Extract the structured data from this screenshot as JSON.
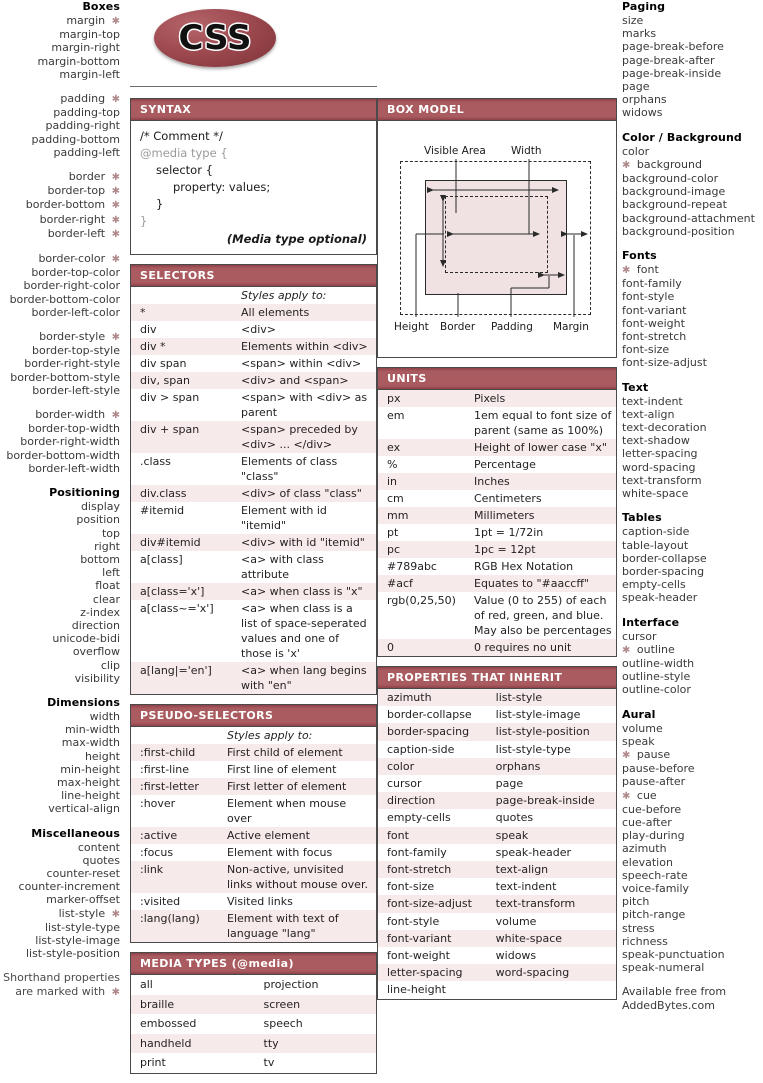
{
  "logo": {
    "text": "CSS"
  },
  "left_column": {
    "groups": [
      {
        "title": "Boxes",
        "items": [
          {
            "label": "margin",
            "star": true
          },
          {
            "label": "margin-top",
            "star": false
          },
          {
            "label": "margin-right",
            "star": false
          },
          {
            "label": "margin-bottom",
            "star": false
          },
          {
            "label": "margin-left",
            "star": false
          }
        ]
      },
      {
        "title": "",
        "items": [
          {
            "label": "padding",
            "star": true
          },
          {
            "label": "padding-top",
            "star": false
          },
          {
            "label": "padding-right",
            "star": false
          },
          {
            "label": "padding-bottom",
            "star": false
          },
          {
            "label": "padding-left",
            "star": false
          }
        ]
      },
      {
        "title": "",
        "items": [
          {
            "label": "border",
            "star": true
          },
          {
            "label": "border-top",
            "star": true
          },
          {
            "label": "border-bottom",
            "star": true
          },
          {
            "label": "border-right",
            "star": true
          },
          {
            "label": "border-left",
            "star": true
          }
        ]
      },
      {
        "title": "",
        "items": [
          {
            "label": "border-color",
            "star": true
          },
          {
            "label": "border-top-color",
            "star": false
          },
          {
            "label": "border-right-color",
            "star": false
          },
          {
            "label": "border-bottom-color",
            "star": false
          },
          {
            "label": "border-left-color",
            "star": false
          }
        ]
      },
      {
        "title": "",
        "items": [
          {
            "label": "border-style",
            "star": true
          },
          {
            "label": "border-top-style",
            "star": false
          },
          {
            "label": "border-right-style",
            "star": false
          },
          {
            "label": "border-bottom-style",
            "star": false
          },
          {
            "label": "border-left-style",
            "star": false
          }
        ]
      },
      {
        "title": "",
        "items": [
          {
            "label": "border-width",
            "star": true
          },
          {
            "label": "border-top-width",
            "star": false
          },
          {
            "label": "border-right-width",
            "star": false
          },
          {
            "label": "border-bottom-width",
            "star": false
          },
          {
            "label": "border-left-width",
            "star": false
          }
        ]
      },
      {
        "title": "Positioning",
        "items": [
          {
            "label": "display",
            "star": false
          },
          {
            "label": "position",
            "star": false
          },
          {
            "label": "top",
            "star": false
          },
          {
            "label": "right",
            "star": false
          },
          {
            "label": "bottom",
            "star": false
          },
          {
            "label": "left",
            "star": false
          },
          {
            "label": "float",
            "star": false
          },
          {
            "label": "clear",
            "star": false
          },
          {
            "label": "z-index",
            "star": false
          },
          {
            "label": "direction",
            "star": false
          },
          {
            "label": "unicode-bidi",
            "star": false
          },
          {
            "label": "overflow",
            "star": false
          },
          {
            "label": "clip",
            "star": false
          },
          {
            "label": "visibility",
            "star": false
          }
        ]
      },
      {
        "title": "Dimensions",
        "items": [
          {
            "label": "width",
            "star": false
          },
          {
            "label": "min-width",
            "star": false
          },
          {
            "label": "max-width",
            "star": false
          },
          {
            "label": "height",
            "star": false
          },
          {
            "label": "min-height",
            "star": false
          },
          {
            "label": "max-height",
            "star": false
          },
          {
            "label": "line-height",
            "star": false
          },
          {
            "label": "vertical-align",
            "star": false
          }
        ]
      },
      {
        "title": "Miscellaneous",
        "items": [
          {
            "label": "content",
            "star": false
          },
          {
            "label": "quotes",
            "star": false
          },
          {
            "label": "counter-reset",
            "star": false
          },
          {
            "label": "counter-increment",
            "star": false
          },
          {
            "label": "marker-offset",
            "star": false
          },
          {
            "label": "list-style",
            "star": true
          },
          {
            "label": "list-style-type",
            "star": false
          },
          {
            "label": "list-style-image",
            "star": false
          },
          {
            "label": "list-style-position",
            "star": false
          }
        ]
      }
    ],
    "footnote_line1": "Shorthand properties",
    "footnote_line2": "are marked with"
  },
  "right_column": {
    "groups": [
      {
        "title": "Paging",
        "items": [
          {
            "label": "size",
            "star": false
          },
          {
            "label": "marks",
            "star": false
          },
          {
            "label": "page-break-before",
            "star": false
          },
          {
            "label": "page-break-after",
            "star": false
          },
          {
            "label": "page-break-inside",
            "star": false
          },
          {
            "label": "page",
            "star": false
          },
          {
            "label": "orphans",
            "star": false
          },
          {
            "label": "widows",
            "star": false
          }
        ]
      },
      {
        "title": "Color / Background",
        "items": [
          {
            "label": "color",
            "star": false
          },
          {
            "label": "background",
            "star": true
          },
          {
            "label": "background-color",
            "star": false
          },
          {
            "label": "background-image",
            "star": false
          },
          {
            "label": "background-repeat",
            "star": false
          },
          {
            "label": "background-attachment",
            "star": false
          },
          {
            "label": "background-position",
            "star": false
          }
        ]
      },
      {
        "title": "Fonts",
        "items": [
          {
            "label": "font",
            "star": true
          },
          {
            "label": "font-family",
            "star": false
          },
          {
            "label": "font-style",
            "star": false
          },
          {
            "label": "font-variant",
            "star": false
          },
          {
            "label": "font-weight",
            "star": false
          },
          {
            "label": "font-stretch",
            "star": false
          },
          {
            "label": "font-size",
            "star": false
          },
          {
            "label": "font-size-adjust",
            "star": false
          }
        ]
      },
      {
        "title": "Text",
        "items": [
          {
            "label": "text-indent",
            "star": false
          },
          {
            "label": "text-align",
            "star": false
          },
          {
            "label": "text-decoration",
            "star": false
          },
          {
            "label": "text-shadow",
            "star": false
          },
          {
            "label": "letter-spacing",
            "star": false
          },
          {
            "label": "word-spacing",
            "star": false
          },
          {
            "label": "text-transform",
            "star": false
          },
          {
            "label": "white-space",
            "star": false
          }
        ]
      },
      {
        "title": "Tables",
        "items": [
          {
            "label": "caption-side",
            "star": false
          },
          {
            "label": "table-layout",
            "star": false
          },
          {
            "label": "border-collapse",
            "star": false
          },
          {
            "label": "border-spacing",
            "star": false
          },
          {
            "label": "empty-cells",
            "star": false
          },
          {
            "label": "speak-header",
            "star": false
          }
        ]
      },
      {
        "title": "Interface",
        "items": [
          {
            "label": "cursor",
            "star": false
          },
          {
            "label": "outline",
            "star": true
          },
          {
            "label": "outline-width",
            "star": false
          },
          {
            "label": "outline-style",
            "star": false
          },
          {
            "label": "outline-color",
            "star": false
          }
        ]
      },
      {
        "title": "Aural",
        "items": [
          {
            "label": "volume",
            "star": false
          },
          {
            "label": "speak",
            "star": false
          },
          {
            "label": "pause",
            "star": true
          },
          {
            "label": "pause-before",
            "star": false
          },
          {
            "label": "pause-after",
            "star": false
          },
          {
            "label": "cue",
            "star": true
          },
          {
            "label": "cue-before",
            "star": false
          },
          {
            "label": "cue-after",
            "star": false
          },
          {
            "label": "play-during",
            "star": false
          },
          {
            "label": "azimuth",
            "star": false
          },
          {
            "label": "elevation",
            "star": false
          },
          {
            "label": "speech-rate",
            "star": false
          },
          {
            "label": "voice-family",
            "star": false
          },
          {
            "label": "pitch",
            "star": false
          },
          {
            "label": "pitch-range",
            "star": false
          },
          {
            "label": "stress",
            "star": false
          },
          {
            "label": "richness",
            "star": false
          },
          {
            "label": "speak-punctuation",
            "star": false
          },
          {
            "label": "speak-numeral",
            "star": false
          }
        ]
      }
    ],
    "credit_line1": "Available free from",
    "credit_line2": "AddedBytes.com"
  },
  "syntax": {
    "title": "SYNTAX",
    "lines": [
      {
        "text": "/* Comment */",
        "indent": 0,
        "muted": false
      },
      {
        "text": "@media type {",
        "indent": 0,
        "muted": true
      },
      {
        "text": "selector {",
        "indent": 1,
        "muted": false
      },
      {
        "text": "property: values;",
        "indent": 2,
        "muted": false
      },
      {
        "text": "}",
        "indent": 1,
        "muted": false
      },
      {
        "text": "}",
        "indent": 0,
        "muted": true
      }
    ],
    "note": "(Media type optional)"
  },
  "selectors": {
    "title": "SELECTORS",
    "header": "Styles apply to:",
    "rows": [
      {
        "key": "*",
        "val": "All elements"
      },
      {
        "key": "div",
        "val": "<div>"
      },
      {
        "key": "div *",
        "val": "Elements within <div>"
      },
      {
        "key": "div span",
        "val": "<span> within <div>"
      },
      {
        "key": "div, span",
        "val": "<div> and <span>"
      },
      {
        "key": "div > span",
        "val": "<span> with <div> as parent"
      },
      {
        "key": "div + span",
        "val": "<span> preceded by <div> ... </div>"
      },
      {
        "key": ".class",
        "val": "Elements of class \"class\""
      },
      {
        "key": "div.class",
        "val": "<div> of class \"class\""
      },
      {
        "key": "#itemid",
        "val": "Element with id \"itemid\""
      },
      {
        "key": "div#itemid",
        "val": "<div> with id \"itemid\""
      },
      {
        "key": "a[class]",
        "val": "<a> with class attribute"
      },
      {
        "key": "a[class='x']",
        "val": "<a> when class is \"x\""
      },
      {
        "key": "a[class~='x']",
        "val": "<a> when class is a list of space-seperated values and one of those is 'x'"
      },
      {
        "key": "a[lang|='en']",
        "val": "<a> when lang begins with \"en\""
      }
    ]
  },
  "pseudo_selectors": {
    "title": "PSEUDO-SELECTORS",
    "header": "Styles apply to:",
    "rows": [
      {
        "key": ":first-child",
        "val": "First child of element"
      },
      {
        "key": ":first-line",
        "val": "First line of element"
      },
      {
        "key": ":first-letter",
        "val": "First letter of element"
      },
      {
        "key": ":hover",
        "val": "Element when mouse over"
      },
      {
        "key": ":active",
        "val": "Active element"
      },
      {
        "key": ":focus",
        "val": "Element with focus"
      },
      {
        "key": ":link",
        "val": "Non-active, unvisited links without mouse over."
      },
      {
        "key": ":visited",
        "val": "Visited links"
      },
      {
        "key": ":lang(lang)",
        "val": "Element with text of language \"lang\""
      }
    ]
  },
  "media_types": {
    "title": "MEDIA TYPES (@media)",
    "rows": [
      {
        "c1": "all",
        "c2": "projection"
      },
      {
        "c1": "braille",
        "c2": "screen"
      },
      {
        "c1": "embossed",
        "c2": "speech"
      },
      {
        "c1": "handheld",
        "c2": "tty"
      },
      {
        "c1": "print",
        "c2": "tv"
      }
    ]
  },
  "box_model": {
    "title": "BOX MODEL",
    "labels": {
      "visible_area": "Visible Area",
      "width": "Width",
      "height": "Height",
      "border": "Border",
      "padding": "Padding",
      "margin": "Margin"
    }
  },
  "units": {
    "title": "UNITS",
    "rows": [
      {
        "key": "px",
        "val": "Pixels"
      },
      {
        "key": "em",
        "val": "1em equal to font size of parent (same as 100%)"
      },
      {
        "key": "ex",
        "val": "Height of lower case \"x\""
      },
      {
        "key": "%",
        "val": "Percentage"
      },
      {
        "key": "in",
        "val": "Inches"
      },
      {
        "key": "cm",
        "val": "Centimeters"
      },
      {
        "key": "mm",
        "val": "Millimeters"
      },
      {
        "key": "pt",
        "val": "1pt = 1/72in"
      },
      {
        "key": "pc",
        "val": "1pc = 12pt"
      },
      {
        "key": "#789abc",
        "val": "RGB Hex Notation"
      },
      {
        "key": "#acf",
        "val": "Equates to \"#aaccff\""
      },
      {
        "key": "rgb(0,25,50)",
        "val": "Value (0 to 255) of each of red, green, and blue. May also be percentages"
      },
      {
        "key": "0",
        "val": "0 requires no unit"
      }
    ]
  },
  "inherit": {
    "title": "PROPERTIES THAT INHERIT",
    "rows": [
      {
        "c1": "azimuth",
        "c2": "list-style"
      },
      {
        "c1": "border-collapse",
        "c2": "list-style-image"
      },
      {
        "c1": "border-spacing",
        "c2": "list-style-position"
      },
      {
        "c1": "caption-side",
        "c2": "list-style-type"
      },
      {
        "c1": "color",
        "c2": "orphans"
      },
      {
        "c1": "cursor",
        "c2": "page"
      },
      {
        "c1": "direction",
        "c2": "page-break-inside"
      },
      {
        "c1": "empty-cells",
        "c2": "quotes"
      },
      {
        "c1": "font",
        "c2": "speak"
      },
      {
        "c1": "font-family",
        "c2": "speak-header"
      },
      {
        "c1": "font-stretch",
        "c2": "text-align"
      },
      {
        "c1": "font-size",
        "c2": "text-indent"
      },
      {
        "c1": "font-size-adjust",
        "c2": "text-transform"
      },
      {
        "c1": "font-style",
        "c2": "volume"
      },
      {
        "c1": "font-variant",
        "c2": "white-space"
      },
      {
        "c1": "font-weight",
        "c2": "widows"
      },
      {
        "c1": "letter-spacing",
        "c2": "word-spacing"
      },
      {
        "c1": "line-height",
        "c2": ""
      }
    ]
  },
  "colors": {
    "header_bg": "#a95b60",
    "header_bg_dark": "#8d4248",
    "stripe": "#f6eaea",
    "border": "#4a4a4a",
    "star": "#b08a8c",
    "box_fill": "#f0e2e2"
  }
}
